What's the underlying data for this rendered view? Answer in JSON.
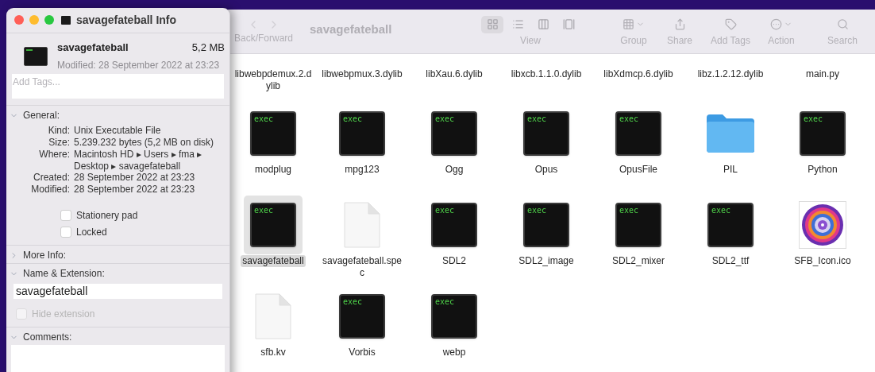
{
  "info_window": {
    "title": "savagefateball Info",
    "file": {
      "name": "savagefateball",
      "size": "5,2 MB",
      "modified": "Modified: 28 September 2022 at 23:23"
    },
    "tags": {
      "placeholder": "Add Tags..."
    },
    "sections": [
      {
        "kind": "general",
        "title": "General:",
        "expanded": true,
        "rows": [
          {
            "label": "Kind:",
            "value": "Unix Executable File"
          },
          {
            "label": "Size:",
            "value": "5.239.232 bytes (5,2 MB on disk)"
          },
          {
            "label": "Where:",
            "value": "Macintosh HD ▸ Users ▸ fma ▸ Desktop ▸ savagefateball"
          },
          {
            "label": "Created:",
            "value": "28 September 2022 at 23:23"
          },
          {
            "label": "Modified:",
            "value": "28 September 2022 at 23:23"
          }
        ],
        "checkboxes": [
          {
            "label": "Stationery pad",
            "checked": false
          },
          {
            "label": "Locked",
            "checked": false
          }
        ]
      },
      {
        "title": "More Info:",
        "expanded": false
      },
      {
        "kind": "name",
        "title": "Name & Extension:",
        "expanded": true,
        "value": "savagefateball",
        "hide_extension": {
          "label": "Hide extension",
          "checked": false,
          "disabled": true
        }
      },
      {
        "kind": "comments",
        "title": "Comments:",
        "expanded": true
      }
    ]
  },
  "finder": {
    "title": "savagefateball",
    "nav": {
      "label": "Back/Forward",
      "disabled": true
    },
    "view": {
      "label": "View",
      "modes": [
        {
          "kind": "icons",
          "selected": true
        },
        {
          "kind": "list",
          "selected": false
        },
        {
          "kind": "columns",
          "selected": false
        },
        {
          "kind": "gallery",
          "selected": false
        }
      ]
    },
    "tools": [
      {
        "kind": "group",
        "label": "Group"
      },
      {
        "kind": "share",
        "label": "Share"
      },
      {
        "kind": "tags",
        "label": "Add Tags"
      },
      {
        "kind": "action",
        "label": "Action"
      },
      {
        "kind": "search",
        "label": "Search"
      }
    ],
    "files": [
      {
        "name": "libwebpdemux.2.dylib",
        "selected": false
      },
      {
        "name": "libwebpmux.3.dylib",
        "selected": false
      },
      {
        "name": "libXau.6.dylib",
        "selected": false
      },
      {
        "name": "libxcb.1.1.0.dylib",
        "selected": false
      },
      {
        "name": "libXdmcp.6.dylib",
        "selected": false
      },
      {
        "name": "libz.1.2.12.dylib",
        "selected": false
      },
      {
        "name": "main.py",
        "selected": false
      },
      {
        "name": "modplug",
        "kind": "exec",
        "icon_text": "exec",
        "selected": false
      },
      {
        "name": "mpg123",
        "kind": "exec",
        "icon_text": "exec",
        "selected": false
      },
      {
        "name": "Ogg",
        "kind": "exec",
        "icon_text": "exec",
        "selected": false
      },
      {
        "name": "Opus",
        "kind": "exec",
        "icon_text": "exec",
        "selected": false
      },
      {
        "name": "OpusFile",
        "kind": "exec",
        "icon_text": "exec",
        "selected": false
      },
      {
        "name": "PIL",
        "kind": "folder",
        "selected": false
      },
      {
        "name": "Python",
        "kind": "exec",
        "icon_text": "exec",
        "selected": false
      },
      {
        "name": "savagefateball",
        "kind": "exec",
        "icon_text": "exec",
        "selected": true
      },
      {
        "name": "savagefateball.spec",
        "kind": "document",
        "selected": false
      },
      {
        "name": "SDL2",
        "kind": "exec",
        "icon_text": "exec",
        "selected": false
      },
      {
        "name": "SDL2_image",
        "kind": "exec",
        "icon_text": "exec",
        "selected": false
      },
      {
        "name": "SDL2_mixer",
        "kind": "exec",
        "icon_text": "exec",
        "selected": false
      },
      {
        "name": "SDL2_ttf",
        "kind": "exec",
        "icon_text": "exec",
        "selected": false
      },
      {
        "name": "SFB_Icon.ico",
        "selected": false
      },
      {
        "name": "sfb.kv",
        "kind": "document",
        "selected": false
      },
      {
        "name": "Vorbis",
        "kind": "exec",
        "icon_text": "exec",
        "selected": false
      },
      {
        "name": "webp",
        "kind": "exec",
        "icon_text": "exec",
        "selected": false
      }
    ]
  }
}
